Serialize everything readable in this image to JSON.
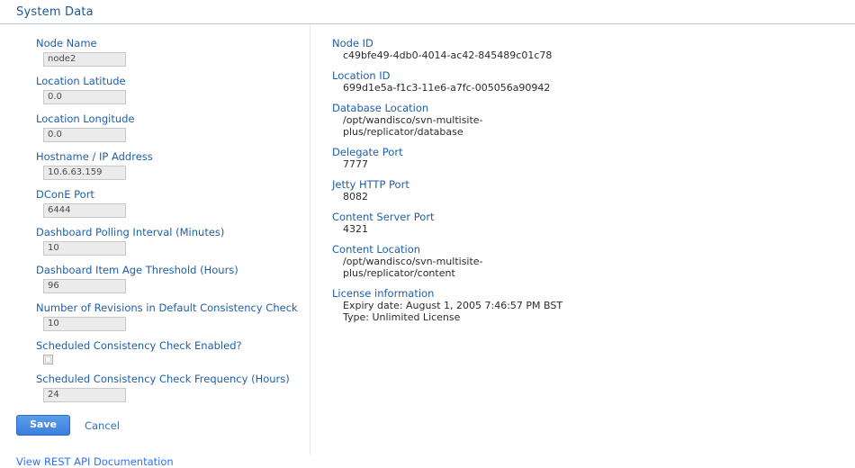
{
  "header": {
    "title": "System Data"
  },
  "form": {
    "fields": [
      {
        "label": "Node Name",
        "value": "node2",
        "type": "text"
      },
      {
        "label": "Location Latitude",
        "value": "0.0",
        "type": "text"
      },
      {
        "label": "Location Longitude",
        "value": "0.0",
        "type": "text"
      },
      {
        "label": "Hostname / IP Address",
        "value": "10.6.63.159",
        "type": "text"
      },
      {
        "label": "DConE Port",
        "value": "6444",
        "type": "text"
      },
      {
        "label": "Dashboard Polling Interval (Minutes)",
        "value": "10",
        "type": "text"
      },
      {
        "label": "Dashboard Item Age Threshold (Hours)",
        "value": "96",
        "type": "text"
      },
      {
        "label": "Number of Revisions in Default Consistency Check",
        "value": "10",
        "type": "text"
      },
      {
        "label": "Scheduled Consistency Check Enabled?",
        "value": "",
        "type": "checkbox",
        "checked": false
      },
      {
        "label": "Scheduled Consistency Check Frequency (Hours)",
        "value": "24",
        "type": "text"
      }
    ],
    "save_label": "Save",
    "cancel_label": "Cancel",
    "doc_link_label": "View REST API Documentation"
  },
  "info": {
    "items": [
      {
        "label": "Node ID",
        "lines": [
          "c49bfe49-4db0-4014-ac42-845489c01c78"
        ]
      },
      {
        "label": "Location ID",
        "lines": [
          "699d1e5a-f1c3-11e6-a7fc-005056a90942"
        ]
      },
      {
        "label": "Database Location",
        "lines": [
          "/opt/wandisco/svn-multisite-",
          "plus/replicator/database"
        ]
      },
      {
        "label": "Delegate Port",
        "lines": [
          "7777"
        ]
      },
      {
        "label": "Jetty HTTP Port",
        "lines": [
          "8082"
        ]
      },
      {
        "label": "Content Server Port",
        "lines": [
          "4321"
        ]
      },
      {
        "label": "Content Location",
        "lines": [
          "/opt/wandisco/svn-multisite-",
          "plus/replicator/content"
        ]
      },
      {
        "label": "License information",
        "lines": [
          "Expiry date: August 1, 2005 7:46:57 PM BST",
          "Type: Unlimited License"
        ]
      }
    ]
  },
  "colors": {
    "label_blue": "#1f5fa9",
    "title_blue": "#20559a",
    "link_blue": "#2e6fff",
    "button_blue": "#3c7fdc"
  }
}
